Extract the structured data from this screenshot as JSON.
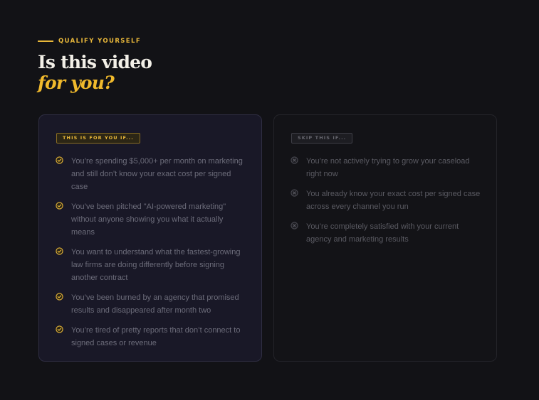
{
  "header": {
    "eyebrow": "QUALIFY YOURSELF",
    "title_line1": "Is this video",
    "title_line2": "for you?"
  },
  "colors": {
    "accent": "#e8b73a",
    "background": "#121216",
    "card_yes_bg": "#191827",
    "card_no_bg": "#131317"
  },
  "yes_card": {
    "tag": "THIS IS FOR YOU IF...",
    "icon": "check-circle-icon",
    "items": [
      "You’re spending $5,000+ per month on marketing and still don’t know your exact cost per signed case",
      "You’ve been pitched \"AI-powered marketing\" without anyone showing you what it actually means",
      "You want to understand what the fastest-growing law firms are doing differently before signing another contract",
      "You’ve been burned by an agency that promised results and disappeared after month two",
      "You’re tired of pretty reports that don’t connect to signed cases or revenue"
    ]
  },
  "no_card": {
    "tag": "SKIP THIS IF...",
    "icon": "x-circle-icon",
    "items": [
      "You’re not actively trying to grow your caseload right now",
      "You already know your exact cost per signed case across every channel you run",
      "You’re completely satisfied with your current agency and marketing results"
    ]
  }
}
